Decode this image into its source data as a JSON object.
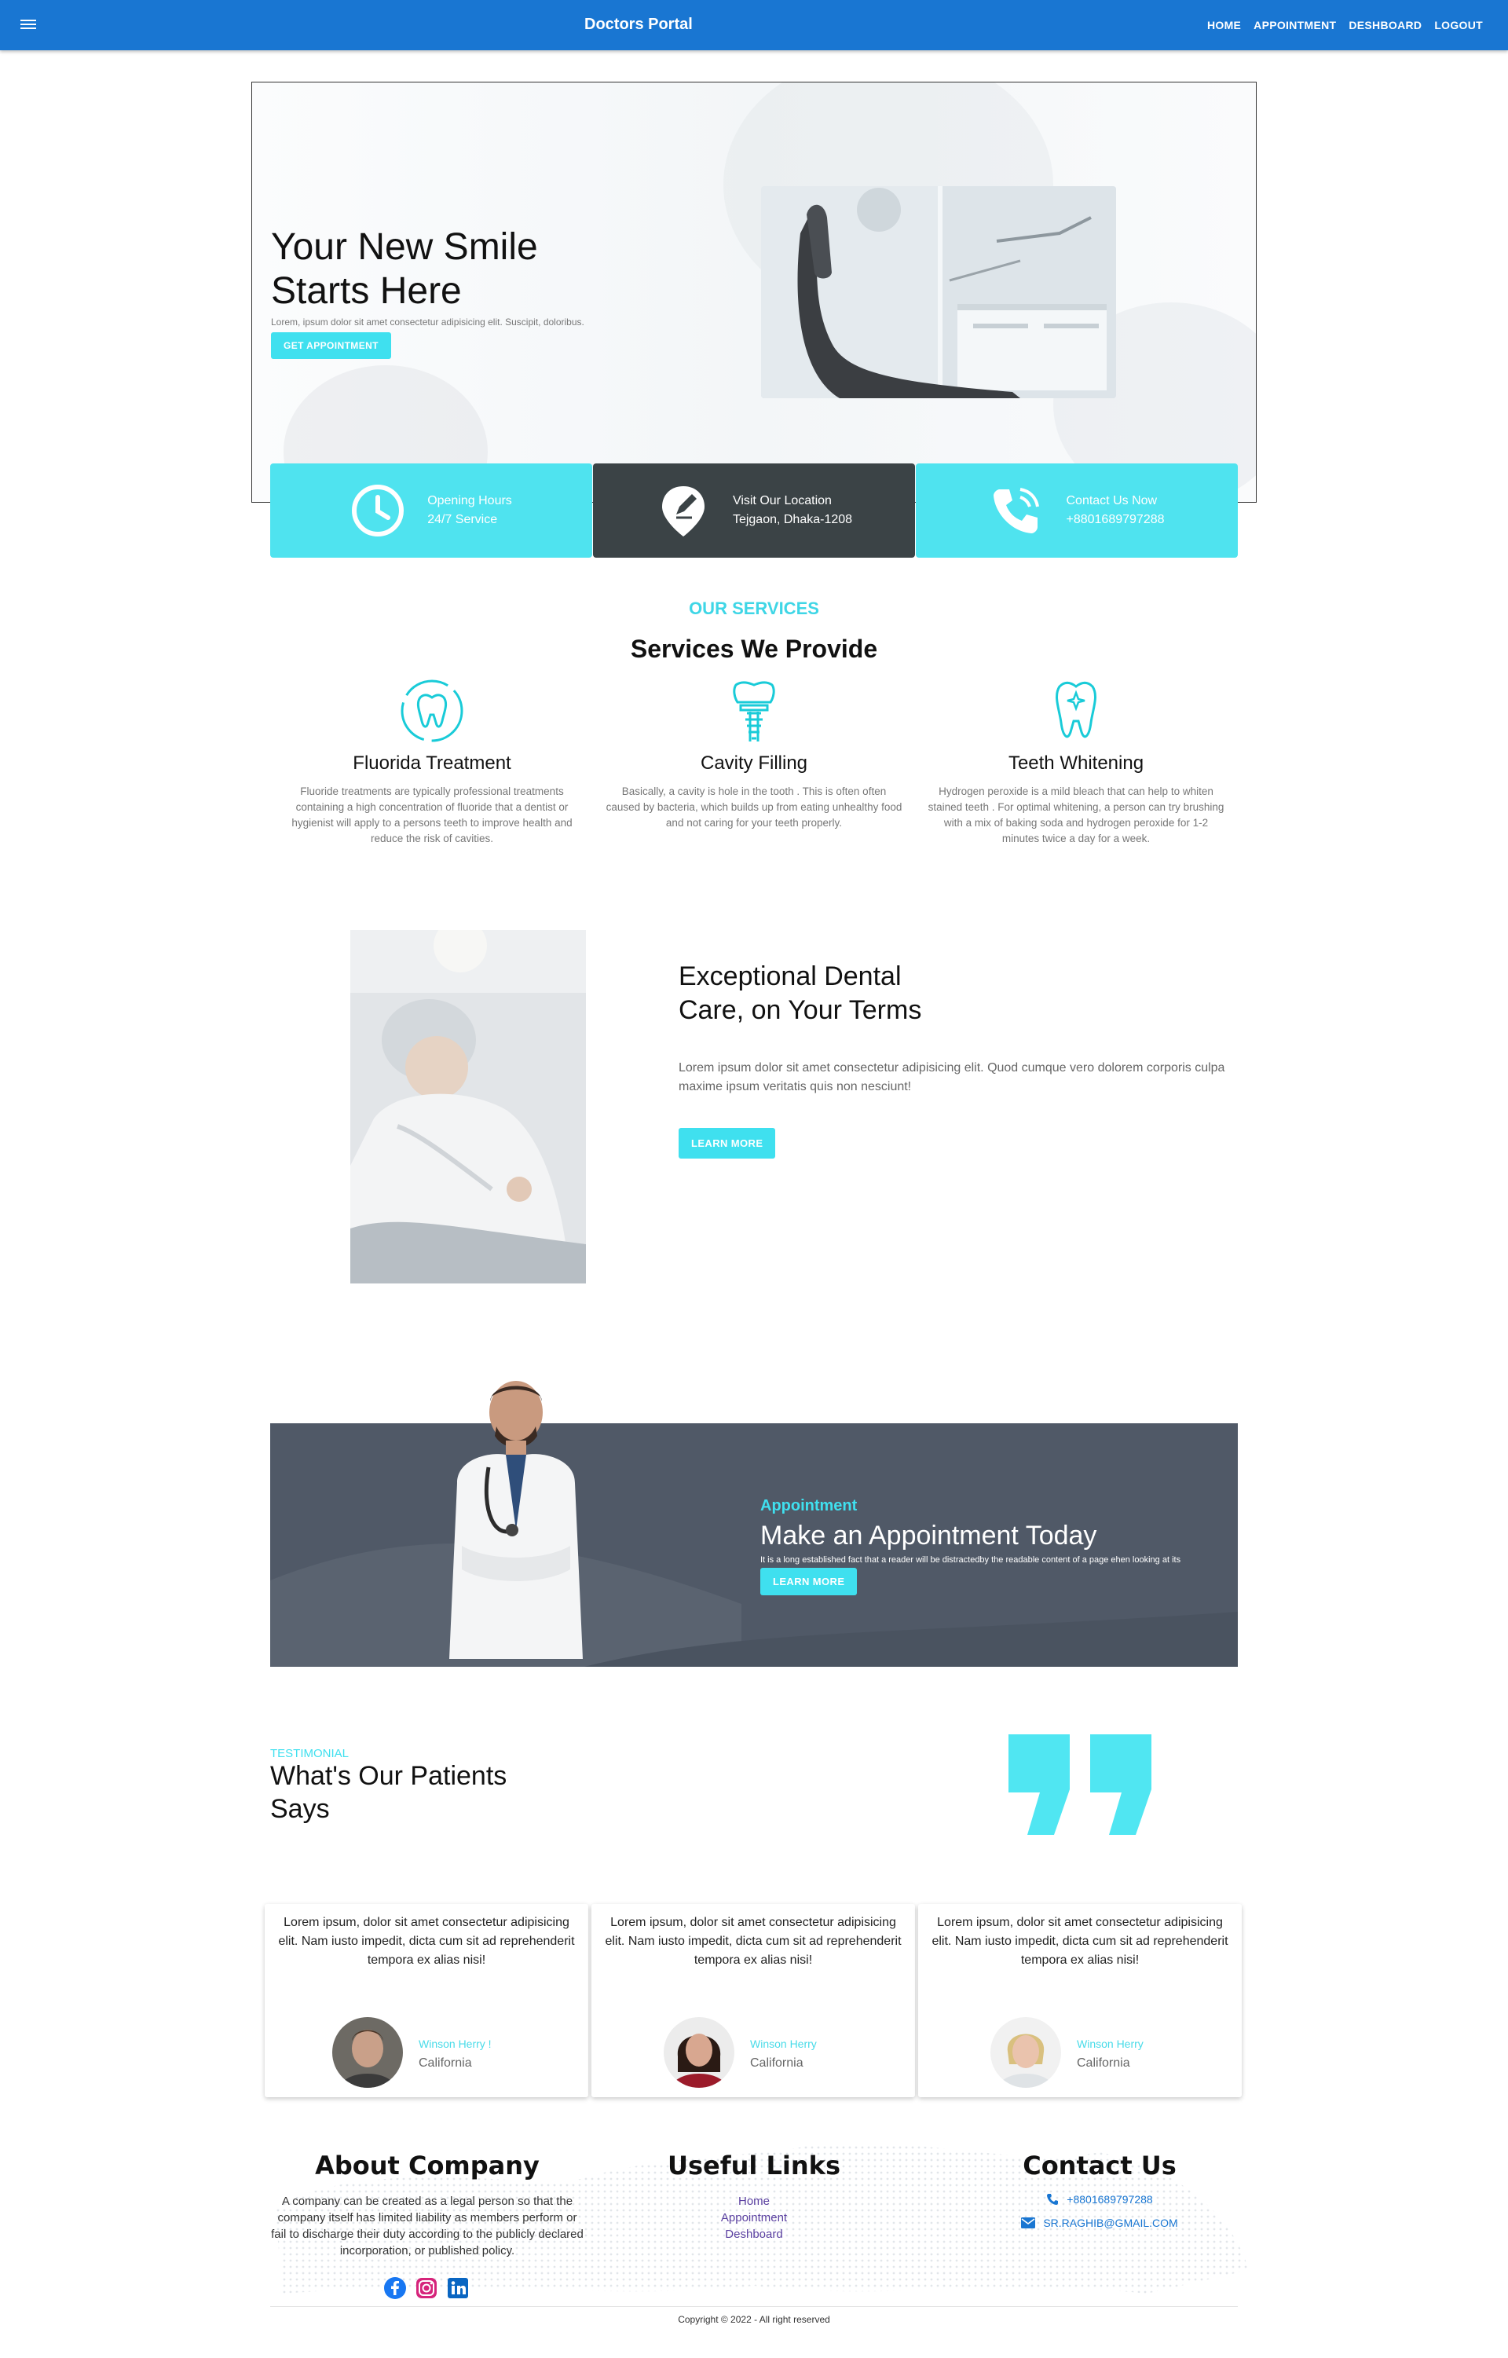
{
  "navbar": {
    "brand": "Doctors Portal",
    "links": [
      "HOME",
      "APPOINTMENT",
      "DESHBOARD",
      "LOGOUT"
    ]
  },
  "hero": {
    "title_line1": "Your New Smile",
    "title_line2": "Starts Here",
    "subtitle": "Lorem, ipsum dolor sit amet consectetur adipisicing elit. Suscipit, doloribus.",
    "button": "GET APPOINTMENT"
  },
  "info_cards": [
    {
      "line1": "Opening Hours",
      "line2": "24/7 Service",
      "icon": "clock-icon"
    },
    {
      "line1": "Visit Our Location",
      "line2": "Tejgaon, Dhaka-1208",
      "icon": "location-icon"
    },
    {
      "line1": "Contact Us Now",
      "line2": "+8801689797288",
      "icon": "phone-icon"
    }
  ],
  "services": {
    "kicker": "OUR SERVICES",
    "title": "Services We Provide",
    "items": [
      {
        "title": "Fluorida Treatment",
        "text": "Fluoride treatments are typically professional treatments containing a high concentration of fluoride that a dentist or hygienist will apply to a persons teeth to improve health and reduce the risk of cavities.",
        "icon": "tooth-fluoride-icon"
      },
      {
        "title": "Cavity Filling",
        "text": "Basically, a cavity is hole in the tooth . This is often often caused by bacteria, which builds up from eating unhealthy food and not caring for your teeth properly.",
        "icon": "tooth-implant-icon"
      },
      {
        "title": "Teeth Whitening",
        "text": "Hydrogen peroxide is a mild bleach that can help to whiten stained teeth . For optimal whitening, a person can try brushing with a mix of baking soda and hydrogen peroxide for 1-2 minutes twice a day for a week.",
        "icon": "tooth-sparkle-icon"
      }
    ]
  },
  "exceptional": {
    "title_line1": "Exceptional Dental",
    "title_line2": "Care, on Your Terms",
    "text": "Lorem ipsum dolor sit amet consectetur adipisicing elit. Quod cumque vero dolorem corporis culpa maxime ipsum veritatis quis non nesciunt!",
    "button": "LEARN MORE"
  },
  "appointment": {
    "kicker": "Appointment",
    "title": "Make an Appointment Today",
    "text": "It is a long established fact that a reader will be distractedby the readable content of a page ehen looking at its",
    "button": "LEARN MORE"
  },
  "testimonial": {
    "kicker": "TESTIMONIAL",
    "title_line1": "What's Our Patients",
    "title_line2": "Says",
    "reviews": [
      {
        "text": "Lorem ipsum, dolor sit amet consectetur adipisicing elit. Nam iusto impedit, dicta cum sit ad reprehenderit tempora ex alias nisi!",
        "name": "Winson Herry !",
        "city": "California"
      },
      {
        "text": "Lorem ipsum, dolor sit amet consectetur adipisicing elit. Nam iusto impedit, dicta cum sit ad reprehenderit tempora ex alias nisi!",
        "name": "Winson Herry",
        "city": "California"
      },
      {
        "text": "Lorem ipsum, dolor sit amet consectetur adipisicing elit. Nam iusto impedit, dicta cum sit ad reprehenderit tempora ex alias nisi!",
        "name": "Winson Herry",
        "city": "California"
      }
    ]
  },
  "footer": {
    "about_title": "About Company",
    "about_text": "A company can be created as a legal person so that the company itself has limited liability as members perform or fail to discharge their duty according to the publicly declared incorporation, or published policy.",
    "links_title": "Useful Links",
    "links": [
      "Home",
      "Appointment",
      "Deshboard"
    ],
    "contact_title": "Contact Us",
    "phone": "+8801689797288",
    "email": "SR.RAGHIB@GMAIL.COM",
    "copyright": "Copyright © 2022 - All right reserved"
  },
  "colors": {
    "primary": "#1976d2",
    "accent": "#3fe0ef",
    "dark": "#3b4346",
    "banner": "#505967"
  }
}
